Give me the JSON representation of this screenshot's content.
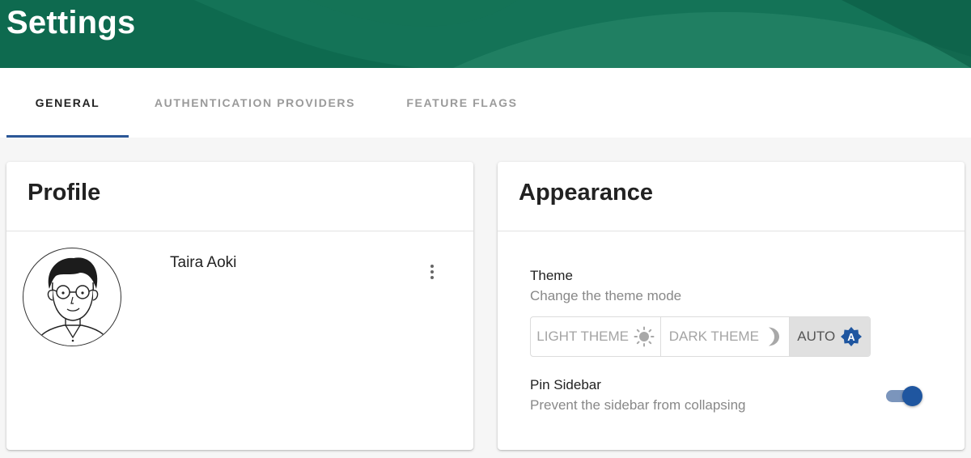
{
  "header": {
    "title": "Settings"
  },
  "tabs": [
    {
      "label": "GENERAL",
      "active": true
    },
    {
      "label": "AUTHENTICATION PROVIDERS",
      "active": false
    },
    {
      "label": "FEATURE FLAGS",
      "active": false
    }
  ],
  "profile": {
    "title": "Profile",
    "name": "Taira Aoki",
    "avatar_icon": "avatar-illustration",
    "more_icon": "more-vert-icon"
  },
  "appearance": {
    "title": "Appearance",
    "theme": {
      "label": "Theme",
      "description": "Change the theme mode",
      "options": [
        {
          "label": "LIGHT THEME",
          "icon": "sun-icon"
        },
        {
          "label": "DARK THEME",
          "icon": "moon-icon"
        },
        {
          "label": "AUTO",
          "icon": "auto-theme-icon"
        }
      ],
      "selected": "AUTO"
    },
    "pin_sidebar": {
      "label": "Pin Sidebar",
      "description": "Prevent the sidebar from collapsing",
      "enabled": true
    }
  },
  "colors": {
    "header_bg": "#0e6a4f",
    "accent": "#2b5797",
    "toggle_on": "#1f56a0"
  }
}
